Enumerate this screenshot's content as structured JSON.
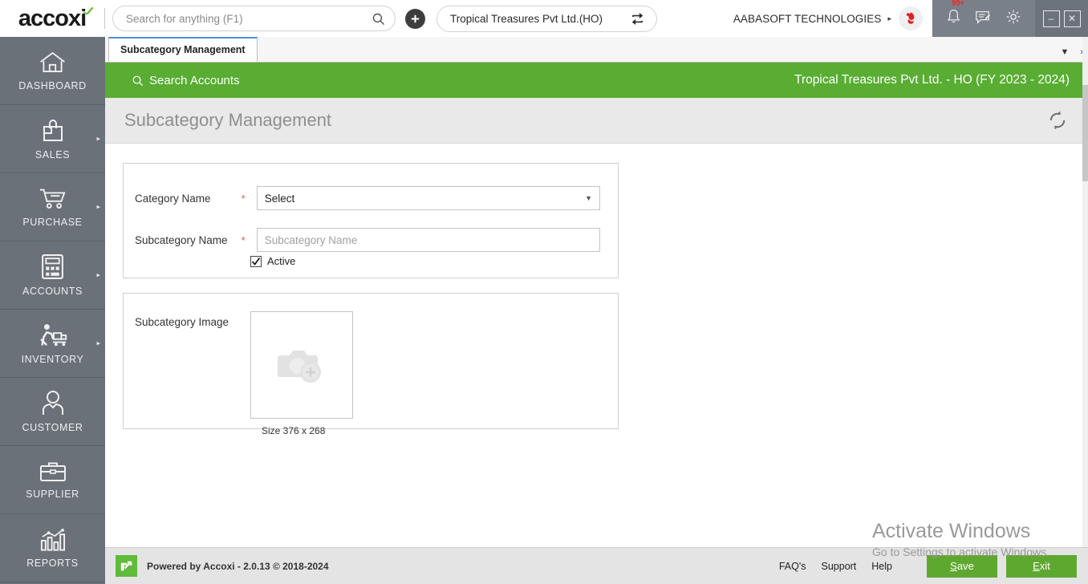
{
  "topbar": {
    "logo_text": "accoxi",
    "search": {
      "placeholder": "Search for anything (F1)",
      "value": ""
    },
    "add_button_label": "+",
    "company_selector": {
      "value": "Tropical Treasures Pvt Ltd.(HO)",
      "switch_icon": "switch-company-icon"
    },
    "org_name": "AABASOFT TECHNOLOGIES",
    "org_caret": "▸",
    "notification_badge": "99+",
    "icons": [
      "bell-icon",
      "message-icon",
      "gear-icon"
    ],
    "window_controls": {
      "minimize": "–",
      "close": "✕"
    }
  },
  "sidebar": {
    "items": [
      {
        "label": "DASHBOARD",
        "icon": "home-icon",
        "has_arrow": false
      },
      {
        "label": "SALES",
        "icon": "shopping-bag-icon",
        "has_arrow": true
      },
      {
        "label": "PURCHASE",
        "icon": "shopping-cart-icon",
        "has_arrow": true
      },
      {
        "label": "ACCOUNTS",
        "icon": "calculator-icon",
        "has_arrow": true
      },
      {
        "label": "INVENTORY",
        "icon": "warehouse-worker-icon",
        "has_arrow": true
      },
      {
        "label": "CUSTOMER",
        "icon": "person-icon",
        "has_arrow": false
      },
      {
        "label": "SUPPLIER",
        "icon": "briefcase-icon",
        "has_arrow": false
      },
      {
        "label": "REPORTS",
        "icon": "bar-chart-icon",
        "has_arrow": false
      }
    ]
  },
  "tabs": {
    "items": [
      {
        "label": "Subcategory Management",
        "active": true
      }
    ],
    "dropdown_icon": "▼",
    "next_icon": "›"
  },
  "greenbar": {
    "search_accounts_label": "Search Accounts",
    "search_icon": "search-icon",
    "company_fy": "Tropical Treasures Pvt Ltd. - HO (FY 2023 - 2024)"
  },
  "pagehead": {
    "title": "Subcategory Management",
    "refresh_icon": "refresh-icon"
  },
  "form": {
    "category_name": {
      "label": "Category Name",
      "required_mark": "*",
      "value": "Select",
      "caret": "▼"
    },
    "subcategory_name": {
      "label": "Subcategory Name",
      "required_mark": "*",
      "value": "",
      "placeholder": "Subcategory Name"
    },
    "active": {
      "label": "Active",
      "checked": true,
      "check_mark": "✓"
    },
    "subcategory_image": {
      "label": "Subcategory Image",
      "placeholder_icon": "camera-add-icon",
      "size_hint": "Size 376 x 268"
    }
  },
  "footer": {
    "powered_by": "Powered by Accoxi - 2.0.13 © 2018-2024",
    "logo_icon": "accoxi-arrow-icon",
    "links": [
      "FAQ's",
      "Support",
      "Help"
    ],
    "save_label_pre": "",
    "save_accel": "S",
    "save_label_post": "ave",
    "exit_accel": "E",
    "exit_label_post": "xit"
  },
  "watermark": {
    "line1": "Activate Windows",
    "line2": "Go to Settings to activate Windows."
  },
  "colors": {
    "brand_green": "#58ad32",
    "button_green": "#5fa830",
    "sidebar_gray": "#6b7178",
    "icon_zone_gray": "#7a8089",
    "required_red": "#e0573d",
    "tab_accent": "#4a90d9"
  }
}
